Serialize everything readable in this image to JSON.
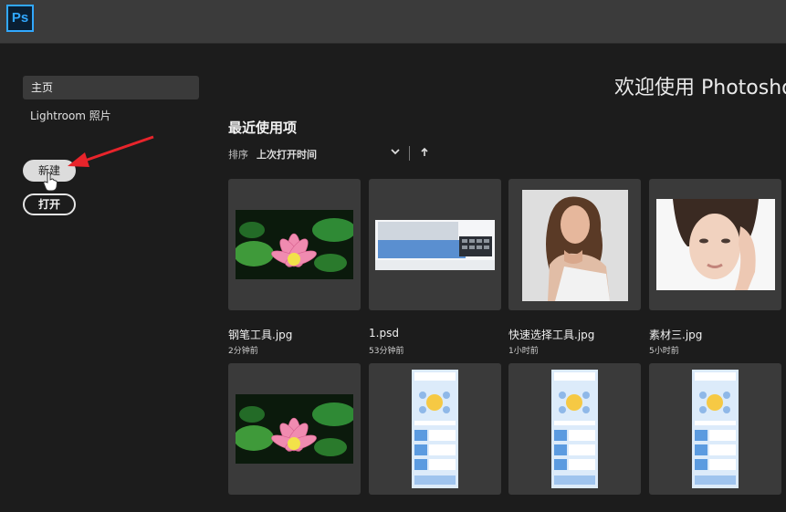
{
  "app": {
    "logo_text": "Ps",
    "welcome": "欢迎使用 Photosho"
  },
  "sidebar": {
    "home": "主页",
    "lightroom": "Lightroom 照片",
    "new_button": "新建",
    "open_button": "打开"
  },
  "recent": {
    "title": "最近使用项",
    "sort_label": "排序",
    "sort_value": "上次打开时间",
    "items": [
      {
        "name": "钢笔工具.jpg",
        "time": "2分钟前",
        "thumb": "lotus-flower"
      },
      {
        "name": "1.psd",
        "time": "53分钟前",
        "thumb": "desk-keyboard-screen"
      },
      {
        "name": "快速选择工具.jpg",
        "time": "1小时前",
        "thumb": "woman-portrait"
      },
      {
        "name": "素材三.jpg",
        "time": "5小时前",
        "thumb": "woman-face-closeup"
      },
      {
        "thumb": "lotus-flower"
      },
      {
        "thumb": "infographic-poster"
      },
      {
        "thumb": "infographic-poster"
      },
      {
        "thumb": "infographic-poster"
      }
    ]
  },
  "colors": {
    "accent": "#31a8ff",
    "arrow": "#e8242b",
    "background": "#1c1c1c",
    "card": "#3a3a3a"
  }
}
